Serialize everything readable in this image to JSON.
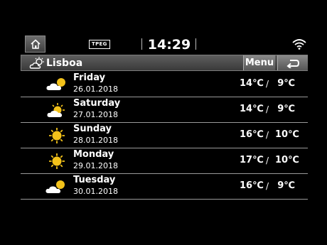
{
  "status": {
    "tpeg_label": "TPEG",
    "time": "14:29"
  },
  "header": {
    "city": "Lisboa",
    "menu_label": "Menu"
  },
  "icons": {
    "home": "home-icon",
    "wifi": "wifi-icon",
    "back": "back-arrow-icon",
    "city_weather": "sun-cloud-icon"
  },
  "colors": {
    "sun": "#f3c21a",
    "cloud": "#ffffff",
    "background": "#000000"
  },
  "forecast": [
    {
      "day": "Friday",
      "date": "26.01.2018",
      "high": "14℃",
      "low": "9℃",
      "condition": "cloudy"
    },
    {
      "day": "Saturday",
      "date": "27.01.2018",
      "high": "14℃",
      "low": "9℃",
      "condition": "partly-cloudy"
    },
    {
      "day": "Sunday",
      "date": "28.01.2018",
      "high": "16℃",
      "low": "10℃",
      "condition": "sunny"
    },
    {
      "day": "Monday",
      "date": "29.01.2018",
      "high": "17℃",
      "low": "10℃",
      "condition": "sunny"
    },
    {
      "day": "Tuesday",
      "date": "30.01.2018",
      "high": "16℃",
      "low": "9℃",
      "condition": "cloudy"
    }
  ],
  "separator": "/"
}
